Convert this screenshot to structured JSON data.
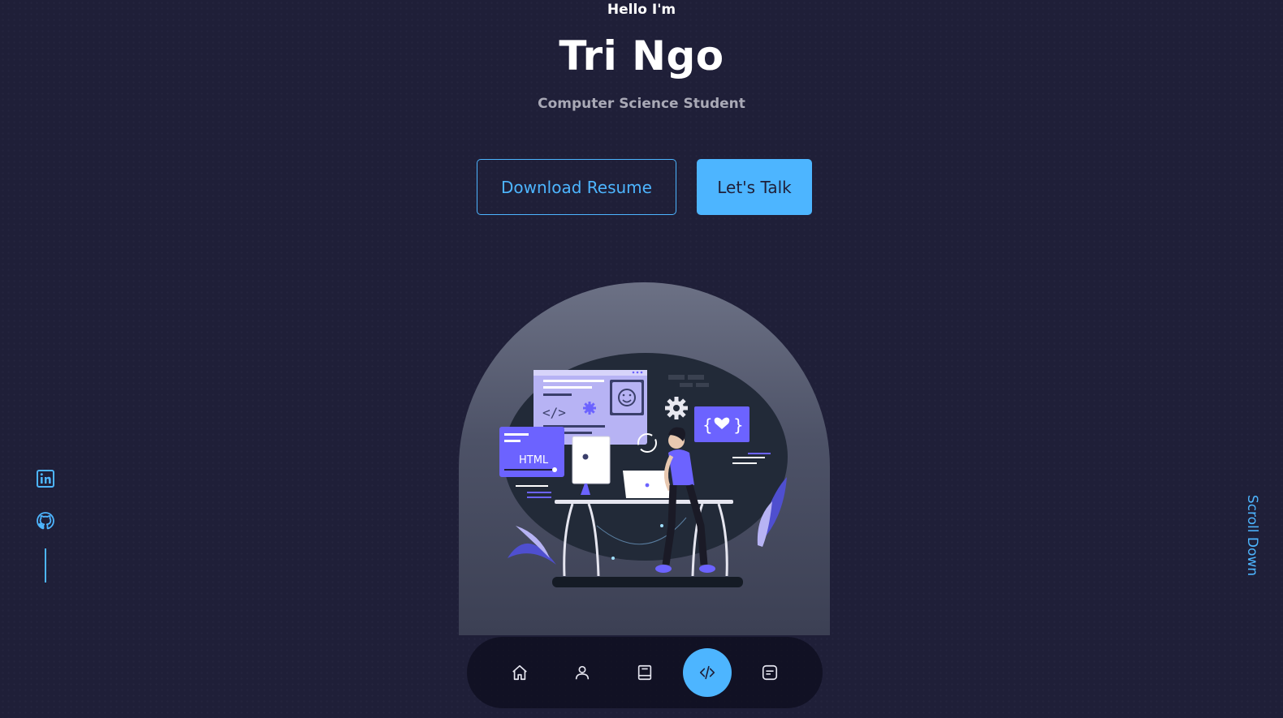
{
  "hero": {
    "greeting": "Hello I'm",
    "name": "Tri Ngo",
    "role": "Computer Science Student"
  },
  "buttons": {
    "download_resume": "Download Resume",
    "lets_talk": "Let's Talk"
  },
  "illustration": {
    "html_label": "HTML"
  },
  "socials": [
    {
      "icon": "linkedin-icon"
    },
    {
      "icon": "github-icon"
    }
  ],
  "scroll_down": "Scroll Down",
  "nav": {
    "items": [
      {
        "icon": "home-icon",
        "active": false
      },
      {
        "icon": "user-icon",
        "active": false
      },
      {
        "icon": "book-icon",
        "active": false
      },
      {
        "icon": "code-icon",
        "active": true
      },
      {
        "icon": "message-icon",
        "active": false
      }
    ]
  },
  "colors": {
    "background": "#1f1f38",
    "accent": "#4db5ff",
    "muted_text": "#a9a9b6",
    "illustration_purple": "#6c63ff"
  }
}
